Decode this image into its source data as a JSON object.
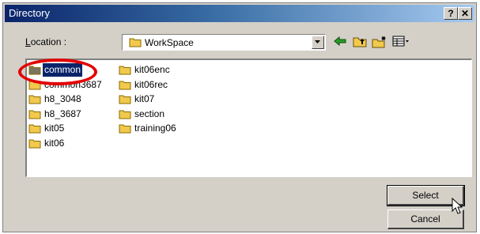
{
  "window": {
    "title": "Directory"
  },
  "titlebar": {
    "help_label": "?",
    "close_label": "✕"
  },
  "location": {
    "label": "Location :",
    "current": "WorkSpace",
    "toolbar_icons": [
      "back-arrow-icon",
      "up-folder-icon",
      "new-folder-icon",
      "view-menu-icon"
    ]
  },
  "folders": [
    {
      "name": "common",
      "selected": true
    },
    {
      "name": "common3687"
    },
    {
      "name": "h8_3048"
    },
    {
      "name": "h8_3687"
    },
    {
      "name": "kit05"
    },
    {
      "name": "kit06"
    },
    {
      "name": "kit06enc"
    },
    {
      "name": "kit06rec"
    },
    {
      "name": "kit07"
    },
    {
      "name": "section"
    },
    {
      "name": "training06"
    }
  ],
  "buttons": {
    "select": "Select",
    "cancel": "Cancel"
  },
  "colors": {
    "title_start": "#0a246a",
    "title_end": "#a6caf0",
    "folder": "#f2c94c",
    "selection": "#0a246a",
    "annotation": "#e30000"
  }
}
